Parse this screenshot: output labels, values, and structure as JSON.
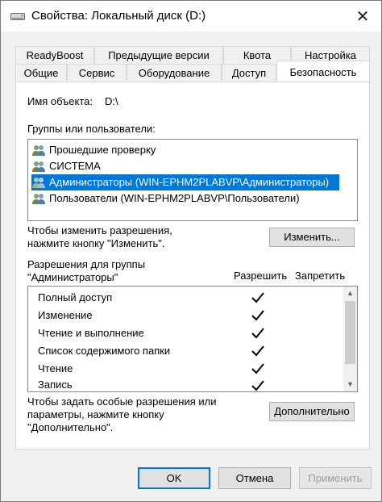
{
  "window": {
    "title": "Свойства: Локальный диск (D:)",
    "close_glyph": "✕",
    "icon": "drive-icon"
  },
  "tabs": {
    "row1": [
      "ReadyBoost",
      "Предыдущие версии",
      "Квота",
      "Настройка"
    ],
    "row2": [
      "Общие",
      "Сервис",
      "Оборудование",
      "Доступ",
      "Безопасность"
    ],
    "active": "Безопасность"
  },
  "object": {
    "label": "Имя объекта:",
    "value": "D:\\"
  },
  "groups": {
    "label": "Группы или пользователи:",
    "items": [
      "Прошедшие проверку",
      "СИСТЕМА",
      "Администраторы (WIN-EPHM2PLABVP\\Администраторы)",
      "Пользователи (WIN-EPHM2PLABVP\\Пользователи)"
    ],
    "selected_index": 2
  },
  "change": {
    "hint_line1": "Чтобы изменить разрешения,",
    "hint_line2": "нажмите кнопку \"Изменить\".",
    "button": "Изменить..."
  },
  "permissions": {
    "label_line1": "Разрешения для группы",
    "label_line2": "\"Администраторы\"",
    "allow_header": "Разрешить",
    "deny_header": "Запретить",
    "rows": [
      {
        "name": "Полный доступ",
        "allow": true,
        "deny": false
      },
      {
        "name": "Изменение",
        "allow": true,
        "deny": false
      },
      {
        "name": "Чтение и выполнение",
        "allow": true,
        "deny": false
      },
      {
        "name": "Список содержимого папки",
        "allow": true,
        "deny": false
      },
      {
        "name": "Чтение",
        "allow": true,
        "deny": false
      },
      {
        "name": "Запись",
        "allow": true,
        "deny": false
      }
    ]
  },
  "advanced": {
    "hint_line1": "Чтобы задать особые разрешения или",
    "hint_line2": "параметры, нажмите кнопку",
    "hint_line3": "\"Дополнительно\".",
    "button": "Дополнительно"
  },
  "footer": {
    "ok": "OK",
    "cancel": "Отмена",
    "apply": "Применить"
  },
  "colors": {
    "selection": "#0078d7",
    "window_bg": "#f0f0f0",
    "panel_bg": "#ffffff"
  }
}
